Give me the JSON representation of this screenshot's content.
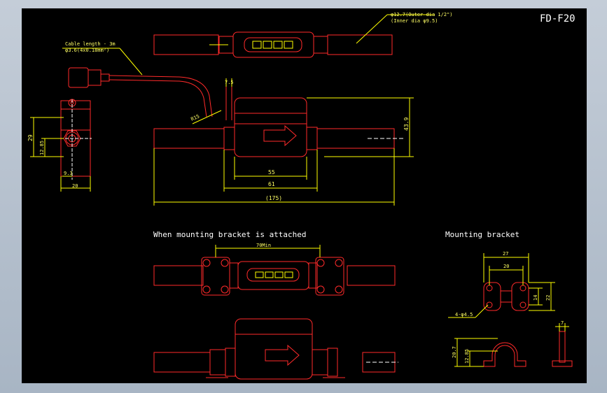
{
  "title": "FD-F20",
  "labels": {
    "cable_1": "Cable length - 3m",
    "cable_2": "φ3.6(4x0.18mm²)",
    "pipe_1": "φ12.7(Outer dia 1/2\")",
    "pipe_2": "(Inner dia φ9.5)",
    "bracket_attached": "When mounting bracket is attached",
    "mounting_bracket": "Mounting bracket",
    "holes": "4-φ4.5"
  },
  "dims": {
    "d7_5": "7.5",
    "r15": "R15",
    "d43_9": "43.9",
    "d55": "55",
    "d61": "61",
    "d175": "(175)",
    "d29": "29",
    "d12_85": "12.85",
    "d9_3": "9.3",
    "d20": "20",
    "d70min": "70Min",
    "b27": "27",
    "b20": "20",
    "b14": "14",
    "b22": "22",
    "b20_7": "20.7",
    "b12_85": "12.85",
    "b7": "7"
  },
  "colors": {
    "background": "#000000",
    "dimension": "#ffff00",
    "outline": "#ff2a2a",
    "centerline": "#ffffff",
    "frame": "#b3bfcd"
  }
}
